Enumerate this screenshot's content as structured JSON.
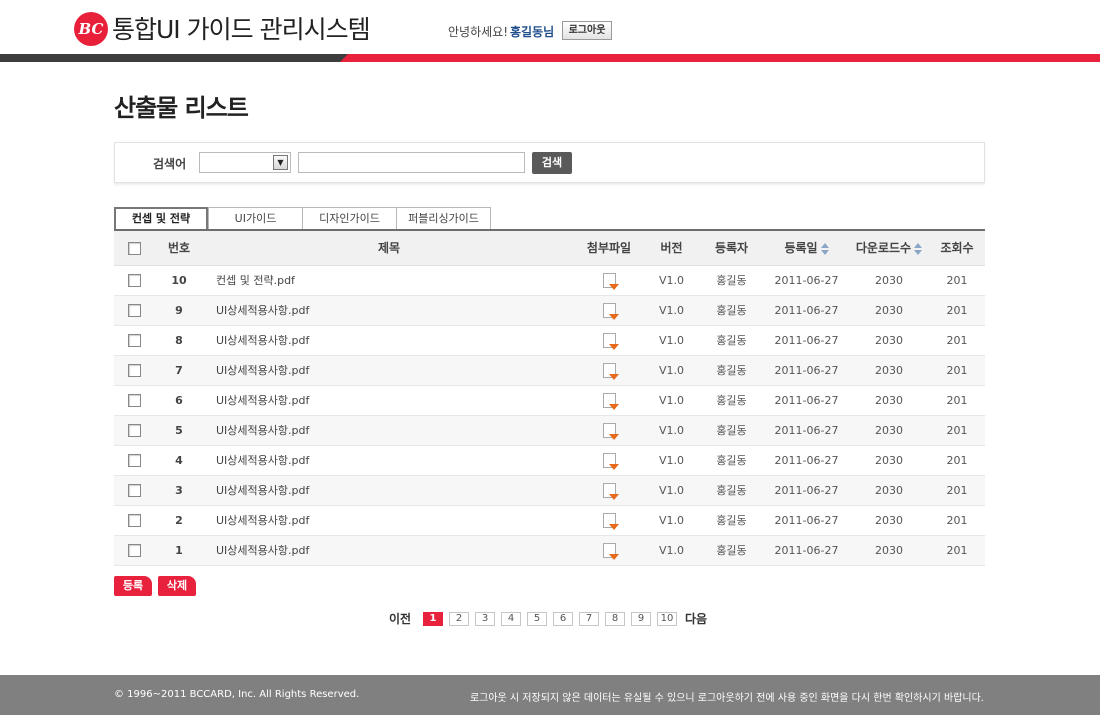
{
  "header": {
    "logo_text": "BC",
    "app_title": "통합UI 가이드 관리시스템",
    "greeting": "안녕하세요!",
    "user_name": "홍길동님",
    "logout_label": "로그아웃"
  },
  "page_title": "산출물 리스트",
  "search": {
    "label": "검색어",
    "select_value": "",
    "input_value": "",
    "button_label": "검색"
  },
  "tabs": [
    {
      "label": "컨셉 및 전략",
      "active": true
    },
    {
      "label": "UI가이드",
      "active": false
    },
    {
      "label": "디자인가이드",
      "active": false
    },
    {
      "label": "퍼블리싱가이드",
      "active": false
    }
  ],
  "table": {
    "headers": {
      "no": "번호",
      "title": "제목",
      "attachment": "첨부파일",
      "version": "버전",
      "author": "등록자",
      "date": "등록일",
      "downloads": "다운로드수",
      "views": "조회수"
    },
    "rows": [
      {
        "no": "10",
        "title": "컨셉 및 전략.pdf",
        "version": "V1.0",
        "author": "홍길동",
        "date": "2011-06-27",
        "downloads": "2030",
        "views": "201"
      },
      {
        "no": "9",
        "title": "UI상세적용사항.pdf",
        "version": "V1.0",
        "author": "홍길동",
        "date": "2011-06-27",
        "downloads": "2030",
        "views": "201"
      },
      {
        "no": "8",
        "title": "UI상세적용사항.pdf",
        "version": "V1.0",
        "author": "홍길동",
        "date": "2011-06-27",
        "downloads": "2030",
        "views": "201"
      },
      {
        "no": "7",
        "title": "UI상세적용사항.pdf",
        "version": "V1.0",
        "author": "홍길동",
        "date": "2011-06-27",
        "downloads": "2030",
        "views": "201"
      },
      {
        "no": "6",
        "title": "UI상세적용사항.pdf",
        "version": "V1.0",
        "author": "홍길동",
        "date": "2011-06-27",
        "downloads": "2030",
        "views": "201"
      },
      {
        "no": "5",
        "title": "UI상세적용사항.pdf",
        "version": "V1.0",
        "author": "홍길동",
        "date": "2011-06-27",
        "downloads": "2030",
        "views": "201"
      },
      {
        "no": "4",
        "title": "UI상세적용사항.pdf",
        "version": "V1.0",
        "author": "홍길동",
        "date": "2011-06-27",
        "downloads": "2030",
        "views": "201"
      },
      {
        "no": "3",
        "title": "UI상세적용사항.pdf",
        "version": "V1.0",
        "author": "홍길동",
        "date": "2011-06-27",
        "downloads": "2030",
        "views": "201"
      },
      {
        "no": "2",
        "title": "UI상세적용사항.pdf",
        "version": "V1.0",
        "author": "홍길동",
        "date": "2011-06-27",
        "downloads": "2030",
        "views": "201"
      },
      {
        "no": "1",
        "title": "UI상세적용사항.pdf",
        "version": "V1.0",
        "author": "홍길동",
        "date": "2011-06-27",
        "downloads": "2030",
        "views": "201"
      }
    ]
  },
  "actions": {
    "register_label": "등록",
    "delete_label": "삭제"
  },
  "pagination": {
    "prev_label": "이전",
    "next_label": "다음",
    "pages": [
      "1",
      "2",
      "3",
      "4",
      "5",
      "6",
      "7",
      "8",
      "9",
      "10"
    ],
    "current": "1"
  },
  "footer": {
    "copyright": "© 1996~2011 BCCARD, Inc. All Rights Reserved.",
    "notice": "로그아웃 시 저장되지 않은 데이터는 유실될 수 있으니 로그아웃하기 전에 사용 중인 화면을 다시 한번 확인하시기 바랍니다."
  },
  "colors": {
    "accent": "#e8213d",
    "dark_bar": "#3d3d3d",
    "footer": "#808080"
  }
}
